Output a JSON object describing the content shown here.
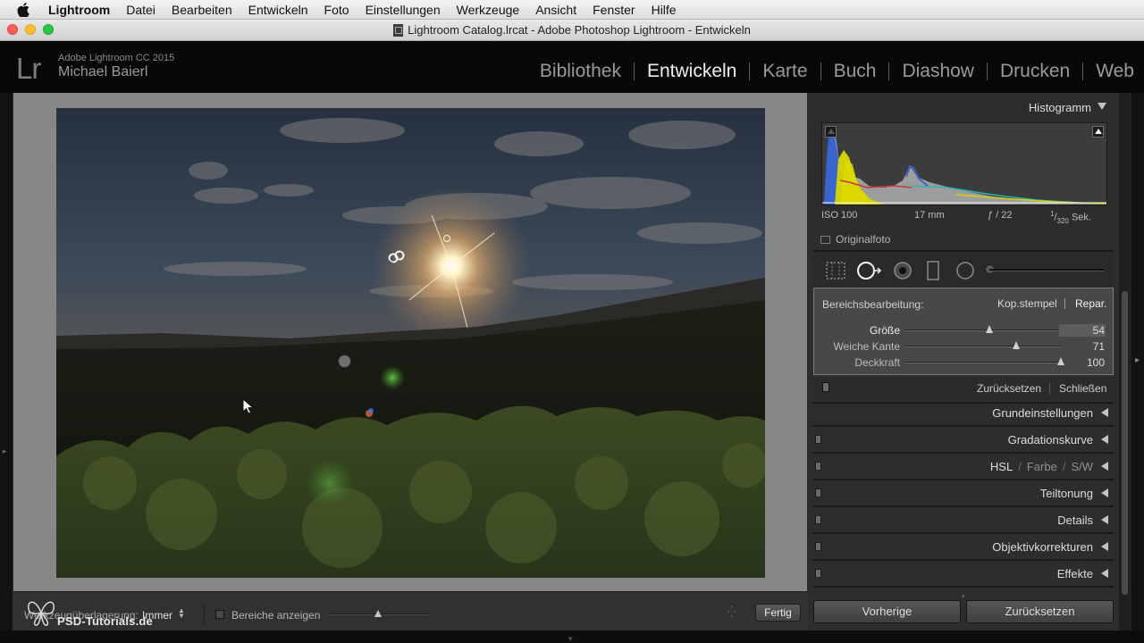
{
  "menubar": {
    "items": [
      "Lightroom",
      "Datei",
      "Bearbeiten",
      "Entwickeln",
      "Foto",
      "Einstellungen",
      "Werkzeuge",
      "Ansicht",
      "Fenster",
      "Hilfe"
    ]
  },
  "window": {
    "title": "Lightroom Catalog.lrcat - Adobe Photoshop Lightroom - Entwickeln"
  },
  "identity": {
    "logo": "Lr",
    "product": "Adobe Lightroom CC 2015",
    "user": "Michael Baierl"
  },
  "modules": {
    "items": [
      "Bibliothek",
      "Entwickeln",
      "Karte",
      "Buch",
      "Diashow",
      "Drucken",
      "Web"
    ],
    "active": "Entwickeln"
  },
  "toolbar": {
    "overlay_label": "Werkzeugüberlagerung:",
    "overlay_value": "Immer",
    "show_areas_label": "Bereiche anzeigen",
    "show_areas_checked": false,
    "visualize_level": 0.5,
    "done_label": "Fertig"
  },
  "watermark": {
    "text": "PSD-Tutorials.de"
  },
  "histogram": {
    "title": "Histogramm",
    "iso": "ISO 100",
    "focal": "17 mm",
    "aperture": "ƒ / 22",
    "shutter_num": "1",
    "shutter_den": "320",
    "shutter_unit": "Sek.",
    "original_label": "Originalfoto"
  },
  "spot_removal": {
    "label": "Bereichsbearbeitung:",
    "mode_clone": "Kop.stempel",
    "mode_heal": "Repar.",
    "active_mode": "Repar.",
    "sliders": [
      {
        "label": "Größe",
        "value": "54",
        "fraction": 0.54,
        "active": true
      },
      {
        "label": "Weiche Kante",
        "value": "71",
        "fraction": 0.71,
        "active": false
      },
      {
        "label": "Deckkraft",
        "value": "100",
        "fraction": 1.0,
        "active": false
      }
    ],
    "reset_label": "Zurücksetzen",
    "close_label": "Schließen"
  },
  "panels": {
    "basic": "Grundeinstellungen",
    "tone_curve": "Gradationskurve",
    "hsl": "HSL",
    "color": "Farbe",
    "bw": "S/W",
    "split_toning": "Teiltonung",
    "detail": "Details",
    "lens": "Objektivkorrekturen",
    "effects": "Effekte"
  },
  "buttons": {
    "previous": "Vorherige",
    "reset": "Zurücksetzen"
  },
  "colors": {
    "panel_bg": "#2d2d2d",
    "canvas_bg": "#878787",
    "active_module": "#ededed"
  }
}
